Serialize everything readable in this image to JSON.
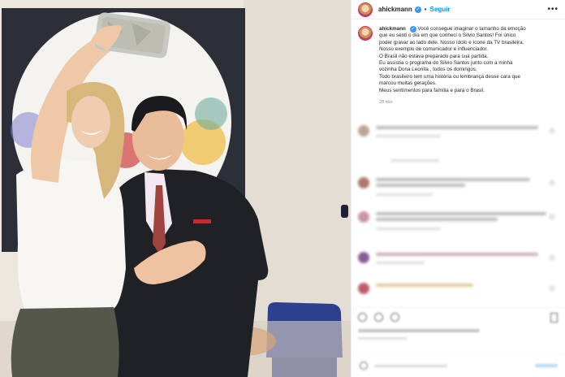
{
  "post": {
    "username": "ahickmann",
    "verified_symbol": "✓",
    "separator": "•",
    "follow_label": "Seguir",
    "more_symbol": "•••",
    "caption_lines": [
      "Você consegue imaginar o tamanho da emoção",
      "que eu senti o dia em que conheci o Silvio Santos! Foi único",
      "poder gravar ao lado dele. Nosso ídolo e ícone da TV brasileira.",
      "Nosso exemplo de comunicador e influenciador.",
      "O Brasil não estava preparado para sua partida.",
      "Eu assistia o programa do Silvio Santos junto com a minha",
      "vozinha Dona Leonita , todos os domingos.",
      "Todo brasileiro tem uma história ou lembrança desse cara que",
      "marcou muitas gerações.",
      "Meus sentimentos para família e para o Brasil."
    ],
    "timestamp": "28 min"
  },
  "icons": {
    "verified": "verified-badge-icon",
    "more": "more-options-icon",
    "like": "heart-icon",
    "comment": "comment-icon",
    "share": "share-icon",
    "save": "bookmark-icon",
    "emoji": "emoji-icon"
  },
  "colors": {
    "follow_blue": "#0095f6",
    "verified_blue": "#3897f0",
    "avatar_ring": "#e1306c",
    "photo_wall": "#e9e3dd"
  }
}
